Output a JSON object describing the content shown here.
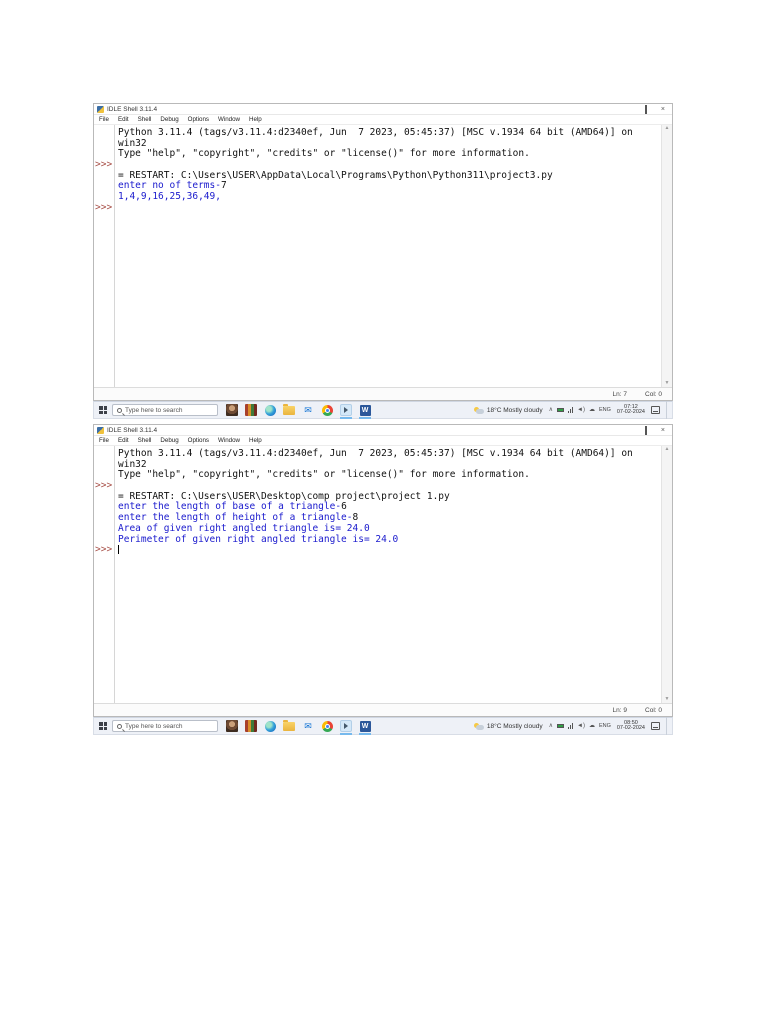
{
  "colors": {
    "stdout_blue": "#1a1acd",
    "prompt_red": "#a85048",
    "text_black": "#111111",
    "active_underline": "#76b9ed"
  },
  "windows": [
    {
      "title": "IDLE Shell 3.11.4",
      "menu": [
        "File",
        "Edit",
        "Shell",
        "Debug",
        "Options",
        "Window",
        "Help"
      ],
      "shell_lines": [
        {
          "gutter": "",
          "segments": [
            {
              "t": "Python 3.11.4 (tags/v3.11.4:d2340ef, Jun  7 2023, 05:45:37) [MSC v.1934 64 bit (AMD64)] on",
              "c": "black"
            }
          ]
        },
        {
          "gutter": "",
          "segments": [
            {
              "t": "win32",
              "c": "black"
            }
          ]
        },
        {
          "gutter": "",
          "segments": [
            {
              "t": "Type \"help\", \"copyright\", \"credits\" or \"license()\" for more information.",
              "c": "black"
            }
          ]
        },
        {
          "gutter": ">>>",
          "segments": []
        },
        {
          "gutter": "",
          "segments": [
            {
              "t": "= RESTART: C:\\Users\\USER\\AppData\\Local\\Programs\\Python\\Python311\\project3.py",
              "c": "black"
            }
          ]
        },
        {
          "gutter": "",
          "segments": [
            {
              "t": "enter no of terms-",
              "c": "blue"
            },
            {
              "t": "7",
              "c": "black"
            }
          ]
        },
        {
          "gutter": "",
          "segments": [
            {
              "t": "1,4,9,16,25,36,49,",
              "c": "blue"
            }
          ]
        },
        {
          "gutter": ">>>",
          "segments": []
        }
      ],
      "cursor_on_last_line": false,
      "status": {
        "line_label": "Ln: 7",
        "col_label": "Col: 0"
      },
      "taskbar": {
        "search_placeholder": "Type here to search",
        "weather": "18°C Mostly cloudy",
        "language": "ENG",
        "time": "07:12",
        "date": "07-02-2024"
      }
    },
    {
      "title": "IDLE Shell 3.11.4",
      "menu": [
        "File",
        "Edit",
        "Shell",
        "Debug",
        "Options",
        "Window",
        "Help"
      ],
      "shell_lines": [
        {
          "gutter": "",
          "segments": [
            {
              "t": "Python 3.11.4 (tags/v3.11.4:d2340ef, Jun  7 2023, 05:45:37) [MSC v.1934 64 bit (AMD64)] on",
              "c": "black"
            }
          ]
        },
        {
          "gutter": "",
          "segments": [
            {
              "t": "win32",
              "c": "black"
            }
          ]
        },
        {
          "gutter": "",
          "segments": [
            {
              "t": "Type \"help\", \"copyright\", \"credits\" or \"license()\" for more information.",
              "c": "black"
            }
          ]
        },
        {
          "gutter": ">>>",
          "segments": []
        },
        {
          "gutter": "",
          "segments": [
            {
              "t": "= RESTART: C:\\Users\\USER\\Desktop\\comp project\\project 1.py",
              "c": "black"
            }
          ]
        },
        {
          "gutter": "",
          "segments": [
            {
              "t": "enter the length of base of a triangle-",
              "c": "blue"
            },
            {
              "t": "6",
              "c": "black"
            }
          ]
        },
        {
          "gutter": "",
          "segments": [
            {
              "t": "enter the length of height of a triangle-",
              "c": "blue"
            },
            {
              "t": "8",
              "c": "black"
            }
          ]
        },
        {
          "gutter": "",
          "segments": [
            {
              "t": "Area of given right angled triangle is= 24.0",
              "c": "blue"
            }
          ]
        },
        {
          "gutter": "",
          "segments": [
            {
              "t": "Perimeter of given right angled triangle is= 24.0",
              "c": "blue"
            }
          ]
        },
        {
          "gutter": ">>>",
          "segments": []
        }
      ],
      "cursor_on_last_line": true,
      "status": {
        "line_label": "Ln: 9",
        "col_label": "Col: 0"
      },
      "taskbar": {
        "search_placeholder": "Type here to search",
        "weather": "18°C Mostly cloudy",
        "language": "ENG",
        "time": "08:50",
        "date": "07-02-2024"
      }
    }
  ],
  "taskbar_icons": [
    {
      "name": "avatar-icon",
      "cls": "ic-avatar",
      "active": false
    },
    {
      "name": "books-icon",
      "cls": "ic-books",
      "active": false
    },
    {
      "name": "edge-icon",
      "cls": "ic-edge",
      "active": false
    },
    {
      "name": "file-explorer-icon",
      "cls": "ic-folder",
      "active": false
    },
    {
      "name": "mail-icon",
      "cls": "ic-mail",
      "glyph": "✉",
      "active": false
    },
    {
      "name": "chrome-icon",
      "cls": "ic-chrome",
      "active": false
    },
    {
      "name": "idle-icon",
      "cls": "ic-idle",
      "active": true
    },
    {
      "name": "word-icon",
      "cls": "ic-word",
      "glyph": "W",
      "active": true
    }
  ]
}
